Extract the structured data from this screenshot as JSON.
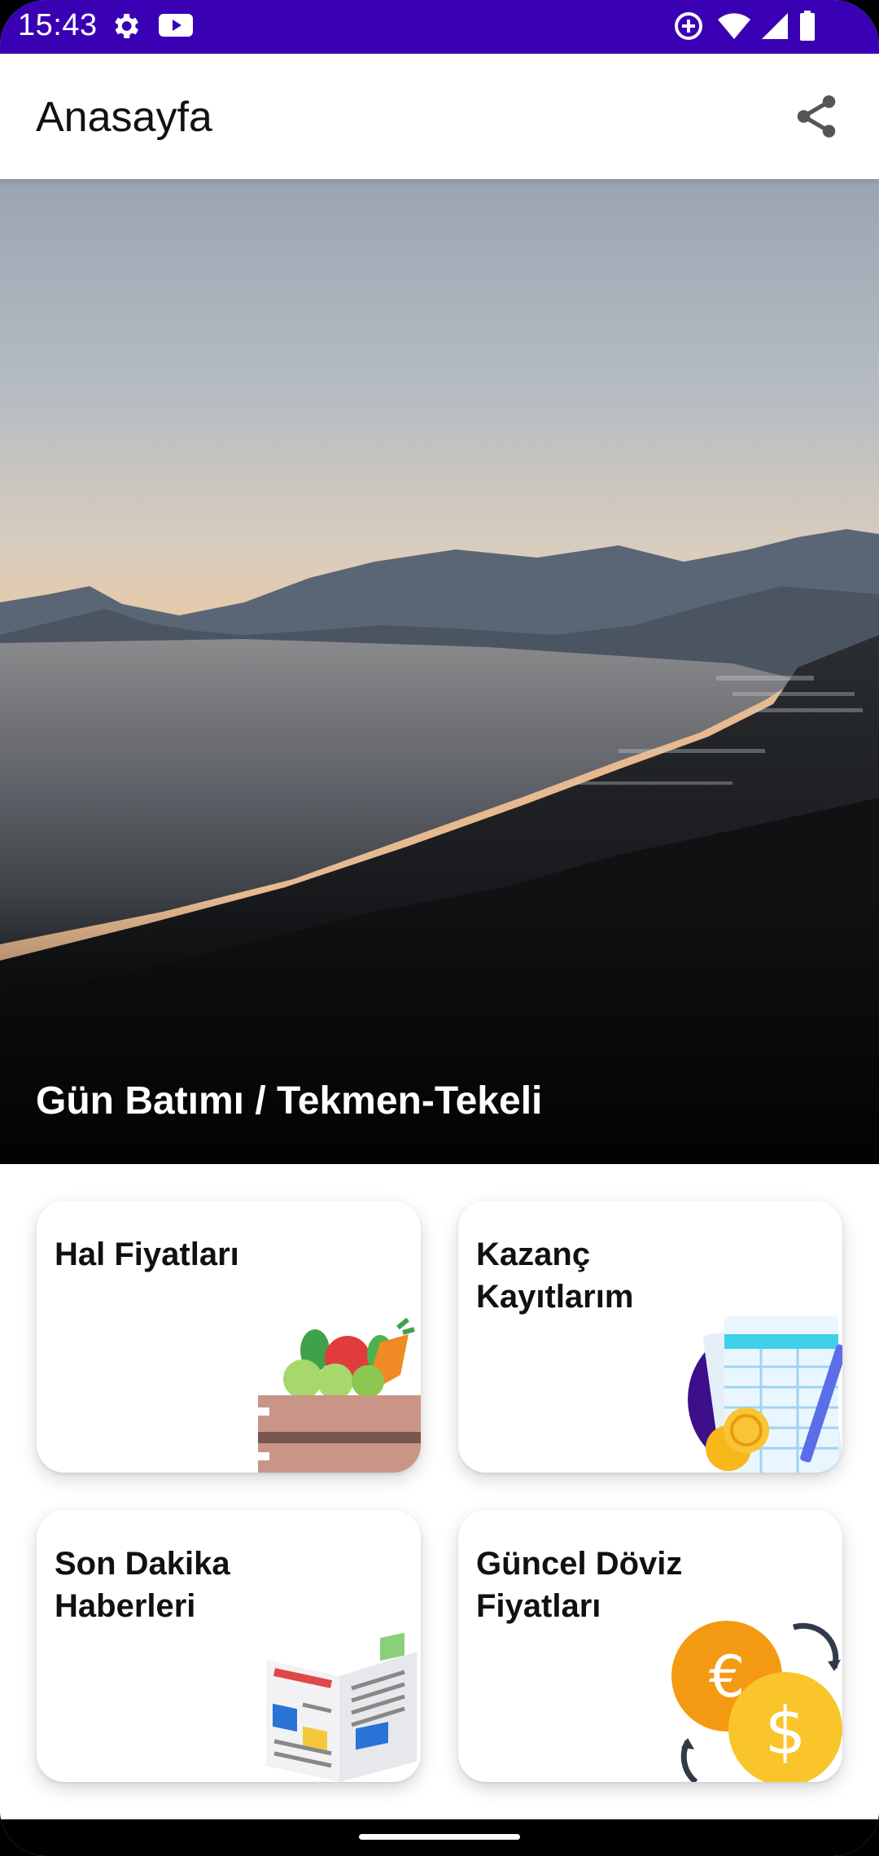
{
  "status_bar": {
    "time": "15:43",
    "left_icons": [
      "settings-icon",
      "youtube-icon"
    ],
    "right_icons": [
      "data-saver-icon",
      "wifi-icon",
      "signal-icon",
      "battery-icon"
    ],
    "background_color": "#3a00b3"
  },
  "app_bar": {
    "title": "Anasayfa",
    "action_icon": "share-icon"
  },
  "hero": {
    "caption": "Gün Batımı / Tekmen-Tekeli"
  },
  "cards": [
    {
      "label": "Hal Fiyatları",
      "icon": "vegetable-crate-icon"
    },
    {
      "label": "Kazanç\nKayıtlarım",
      "icon": "ledger-coins-icon"
    },
    {
      "label": "Son Dakika\nHaberleri",
      "icon": "newspaper-icon"
    },
    {
      "label": "Güncel Döviz\nFiyatları",
      "icon": "currency-exchange-icon"
    }
  ]
}
